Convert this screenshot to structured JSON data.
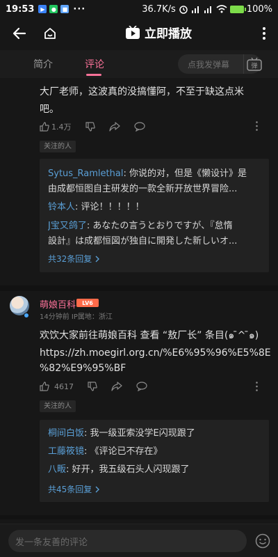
{
  "status": {
    "time": "19:53",
    "dots": "···",
    "speed": "36.7K/s",
    "battery": "100%"
  },
  "header": {
    "title": "立即播放"
  },
  "tabs": [
    {
      "label": "简介"
    },
    {
      "label": "评论"
    }
  ],
  "danmu": {
    "placeholder": "点我发弹幕",
    "button_label": "弹"
  },
  "comment1": {
    "text_line1": "大厂老师，这波真的没搞懂阿，不至于缺这点米",
    "text_line2": "吧。",
    "likes": "1.4万",
    "tag": "关注的人",
    "replies": [
      {
        "user": "Sytus_Ramlethal",
        "line1": ": 你说的对，但是《懒设计》是",
        "line2": "由成都恒图自主研发的一款全新开放世界冒险..."
      },
      {
        "user": "铃本人",
        "line1": ": 评论！！！！！",
        "line2": ""
      },
      {
        "user": "J宝又鸽了",
        "line1": ": あなたの言うとおりですが、『怠惰",
        "line2": "設計』は成都恒図が独自に開発した新しいオ..."
      }
    ],
    "more_replies": "共32条回复"
  },
  "comment2": {
    "user": "萌娘百科",
    "level": "LV6",
    "meta": "14分钟前  IP属地：浙江",
    "text_line1": "欢饮大家前往萌娘百科  查看 “敖厂长” 条目(๑ ̄^ ̄๑)",
    "text_line2": "https://zh.moegirl.org.cn/%E6%95%96%E5%8E",
    "text_line3": "%82%E9%95%BF",
    "likes": "4617",
    "tag": "关注的人",
    "replies": [
      {
        "user": "桐间白饭",
        "text": ": 我一级亚索没学E闪现跟了"
      },
      {
        "user": "工藤筱镜",
        "text": ": 《评论已不存在》"
      },
      {
        "user": "八畈",
        "text": ": 好开，我五级石头人闪现跟了"
      }
    ],
    "more_replies": "共45条回复"
  },
  "bottom": {
    "placeholder": "发一条友善的评论"
  },
  "colors": {
    "accent": "#fb7299",
    "link": "#5a9fd6",
    "background": "#171717"
  }
}
